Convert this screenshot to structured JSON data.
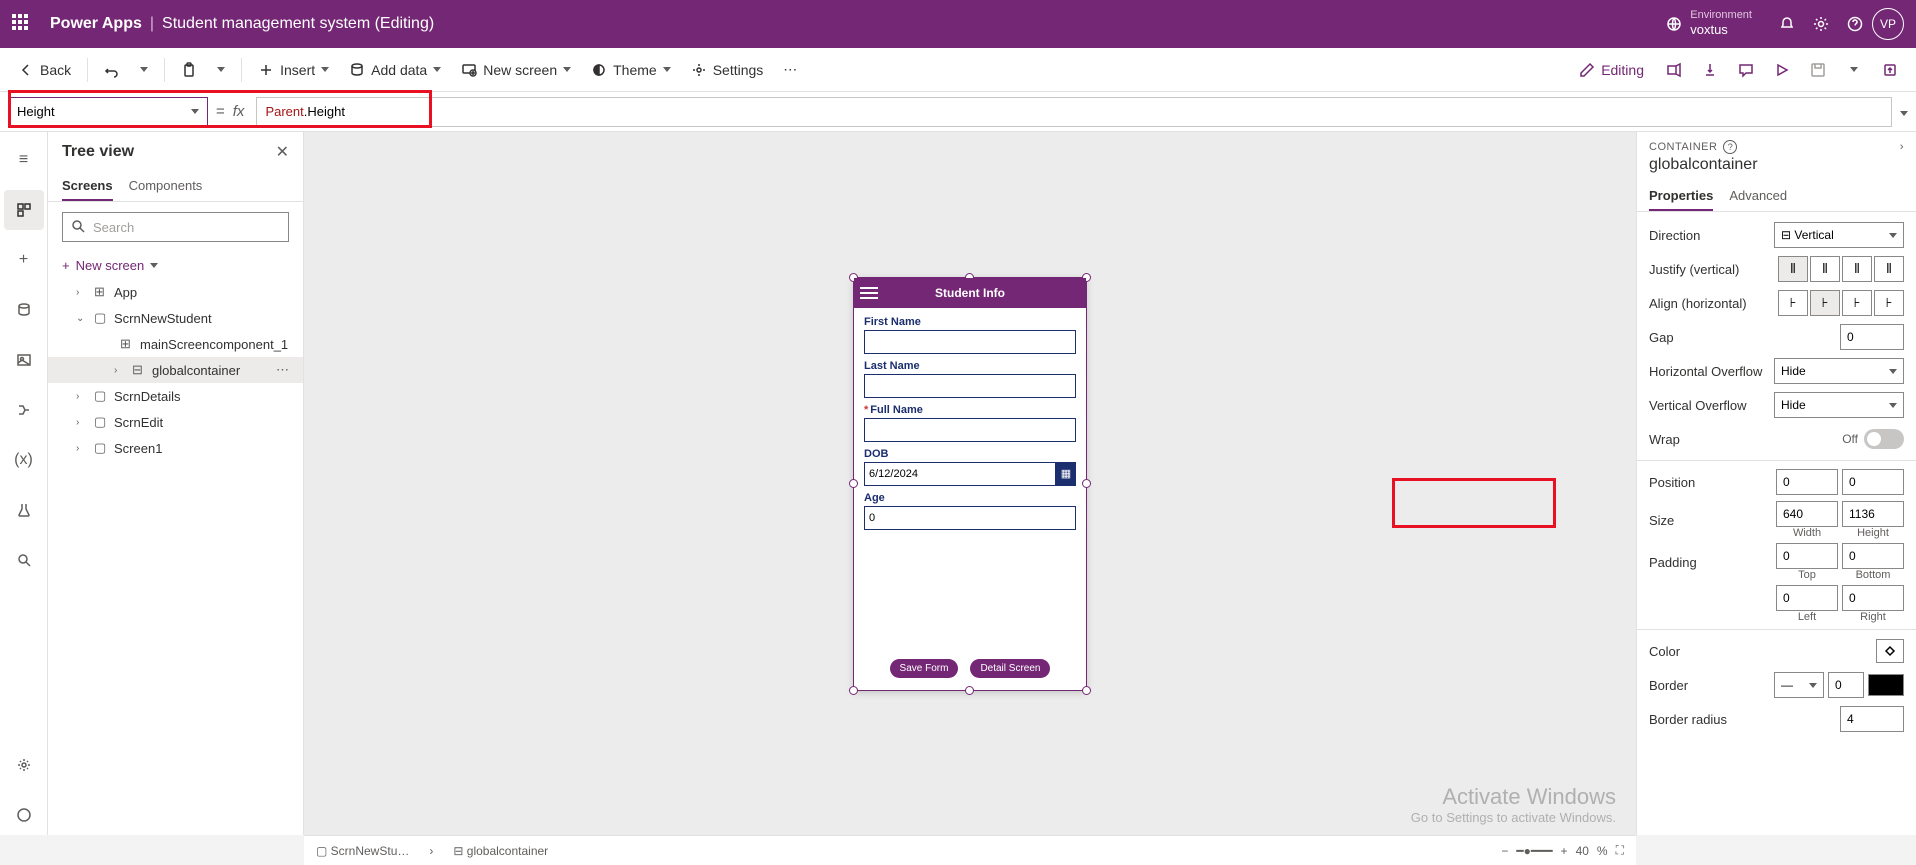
{
  "topbar": {
    "brand": "Power Apps",
    "doc": "Student management system (Editing)",
    "env_label": "Environment",
    "env_value": "voxtus",
    "avatar": "VP"
  },
  "cmdbar": {
    "back": "Back",
    "insert": "Insert",
    "add_data": "Add data",
    "new_screen": "New screen",
    "theme": "Theme",
    "settings": "Settings",
    "editing": "Editing"
  },
  "formula": {
    "property": "Height",
    "value_kw": "Parent",
    "value_rest": ".Height"
  },
  "tree": {
    "title": "Tree view",
    "tabs": {
      "screens": "Screens",
      "components": "Components"
    },
    "search_ph": "Search",
    "new_screen": "New screen",
    "nodes": {
      "app": "App",
      "scrn_new": "ScrnNewStudent",
      "main_comp": "mainScreencomponent_1",
      "global": "globalcontainer",
      "details": "ScrnDetails",
      "edit": "ScrnEdit",
      "screen1": "Screen1"
    }
  },
  "phone": {
    "title": "Student Info",
    "first_name": "First Name",
    "last_name": "Last Name",
    "full_name": "Full Name",
    "dob": "DOB",
    "dob_val": "6/12/2024",
    "age": "Age",
    "age_val": "0",
    "save": "Save Form",
    "detail": "Detail Screen"
  },
  "props": {
    "category": "CONTAINER",
    "name": "globalcontainer",
    "tabs": {
      "properties": "Properties",
      "advanced": "Advanced"
    },
    "direction": "Direction",
    "direction_val": "Vertical",
    "justify": "Justify (vertical)",
    "align": "Align (horizontal)",
    "gap": "Gap",
    "gap_val": "0",
    "hover": "Horizontal Overflow",
    "hover_val": "Hide",
    "vover": "Vertical Overflow",
    "vover_val": "Hide",
    "wrap": "Wrap",
    "wrap_val": "Off",
    "position": "Position",
    "pos_x": "0",
    "pos_y": "0",
    "size": "Size",
    "width": "640",
    "height": "1136",
    "width_lbl": "Width",
    "height_lbl": "Height",
    "padding": "Padding",
    "pad_t": "0",
    "pad_b": "0",
    "pad_l": "0",
    "pad_r": "0",
    "top": "Top",
    "bottom": "Bottom",
    "left": "Left",
    "right": "Right",
    "color": "Color",
    "border": "Border",
    "border_val": "0",
    "radius": "Border radius",
    "radius_val": "4"
  },
  "status": {
    "crumb": "ScrnNewStu…",
    "sel": "globalcontainer",
    "zoom": "40",
    "zoom_unit": "%"
  },
  "watermark": {
    "l1": "Activate Windows",
    "l2": "Go to Settings to activate Windows."
  }
}
